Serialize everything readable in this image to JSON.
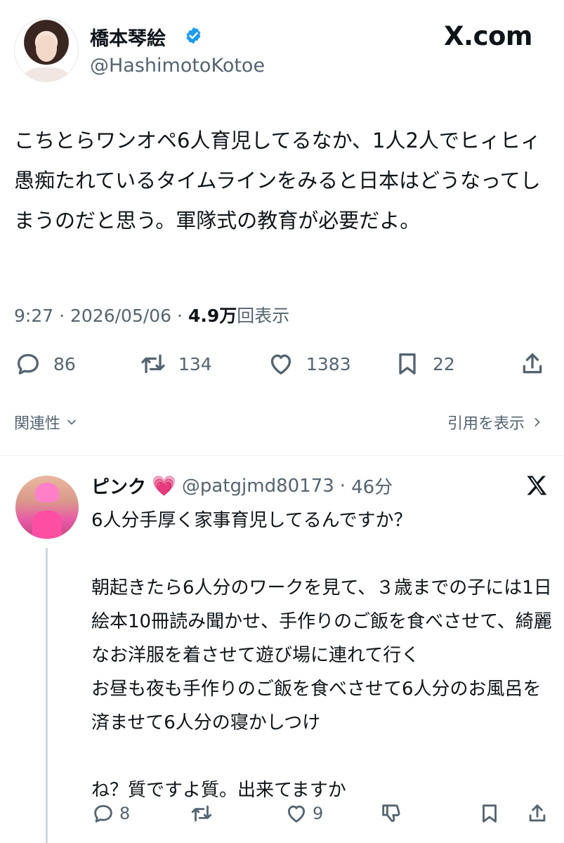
{
  "tweet": {
    "author_name": "橋本琴絵",
    "handle": "@HashimotoKotoe",
    "site_label": "X.com",
    "text": "こちとらワンオペ6人育児してるなか、1人2人でヒィヒィ愚痴たれているタイムラインをみると日本はどうなってしまうのだと思う。軍隊式の教育が必要だよ。",
    "time": "9:27",
    "date": "2026/05/06",
    "views_value": "4.9万",
    "views_label": "回表示",
    "replies": "86",
    "reposts": "134",
    "likes": "1383",
    "bookmarks": "22"
  },
  "links": {
    "related": "関連性",
    "quotes": "引用を表示"
  },
  "reply": {
    "author_name": "ピンク",
    "emoji": "💗",
    "handle": "@patgjmd80173",
    "age": "46分",
    "text": "6人分手厚く家事育児してるんですか？\n\n朝起きたら6人分のワークを見て、３歳までの子には1日絵本10冊読み聞かせ、手作りのご飯を食べさせて、綺麗なお洋服を着させて遊び場に連れて行く\nお昼も夜も手作りのご飯を食べさせて6人分のお風呂を済ませて6人分の寝かしつけ\n\nね？質ですよ質。出来てますか",
    "replies": "8",
    "reposts": "",
    "likes": "9"
  },
  "colors": {
    "text": "#0f1419",
    "secondary": "#536471",
    "verified": "#1d9bf0",
    "divider": "#eff3f4"
  },
  "icons": [
    "verified-badge-icon",
    "reply-icon",
    "repost-icon",
    "like-icon",
    "bookmark-icon",
    "share-icon",
    "chevron-down-icon",
    "chevron-right-icon",
    "x-logo-icon",
    "dislike-icon"
  ]
}
